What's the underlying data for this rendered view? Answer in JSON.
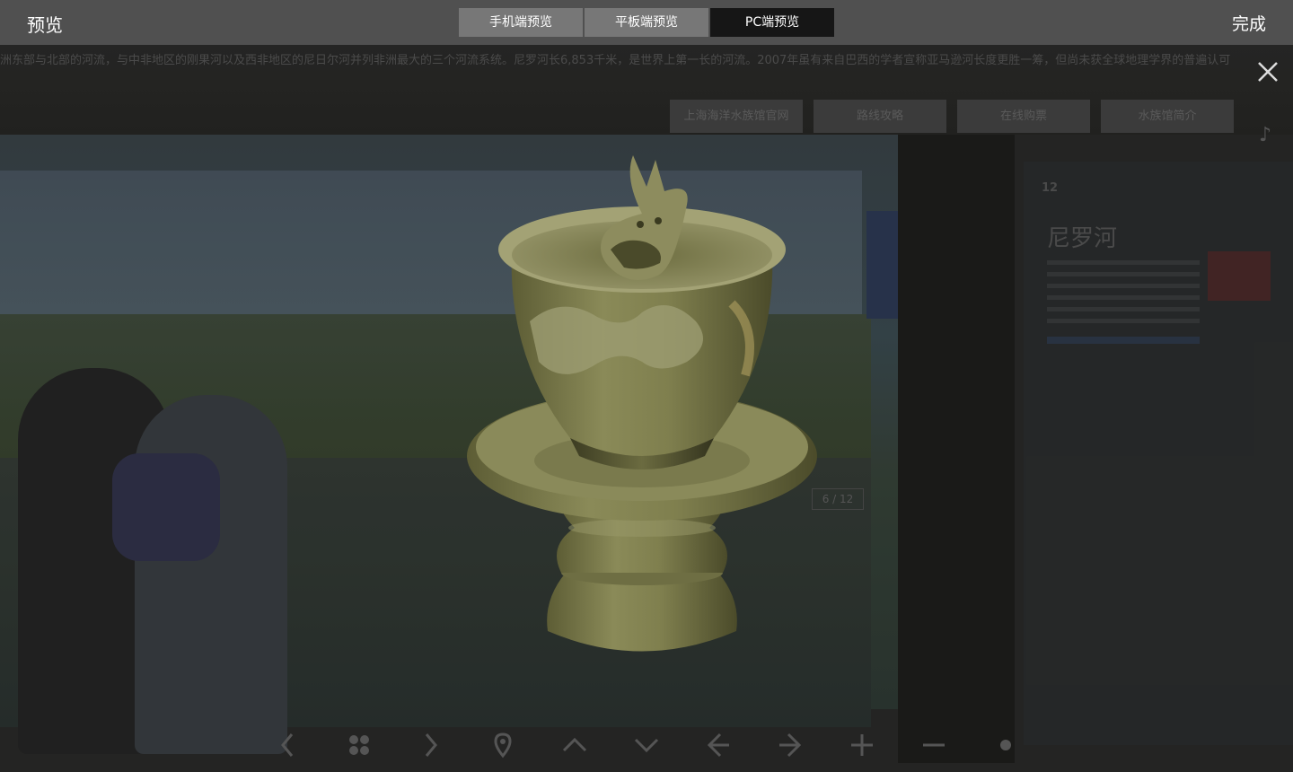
{
  "header": {
    "title": "预览",
    "done_label": "完成",
    "tabs": [
      {
        "label": "手机端预览",
        "active": false
      },
      {
        "label": "平板端预览",
        "active": false
      },
      {
        "label": "PC端预览",
        "active": true
      }
    ]
  },
  "viewer": {
    "marquee_text": "洲东部与北部的河流，与中非地区的刚果河以及西非地区的尼日尔河并列非洲最大的三个河流系统。尼罗河长6,853千米，是世界上第一长的河流。2007年虽有来自巴西的学者宣称亚马逊河长度更胜一筹，但尚未获全球地理学界的普遍认可",
    "nav_buttons": [
      {
        "label": "上海海洋水族馆官网"
      },
      {
        "label": "路线攻略"
      },
      {
        "label": "在线购票"
      },
      {
        "label": "水族馆简介"
      }
    ],
    "music_icon": "music-note-icon",
    "close_icon": "close-icon",
    "panel_title": "尼罗河",
    "panel_number": "12",
    "pager_text": "6 / 12"
  },
  "toolbar": {
    "icons": [
      "prev-icon",
      "grid-icon",
      "next-icon",
      "location-icon",
      "up-icon",
      "down-icon",
      "left-arrow-icon",
      "right-arrow-icon",
      "zoom-in-icon",
      "zoom-out-icon",
      "dot-icon"
    ]
  },
  "colors": {
    "topbar": "#505050",
    "active_tab": "#161616",
    "inactive_tab": "#777777",
    "celadon": "#7a7a4a"
  }
}
